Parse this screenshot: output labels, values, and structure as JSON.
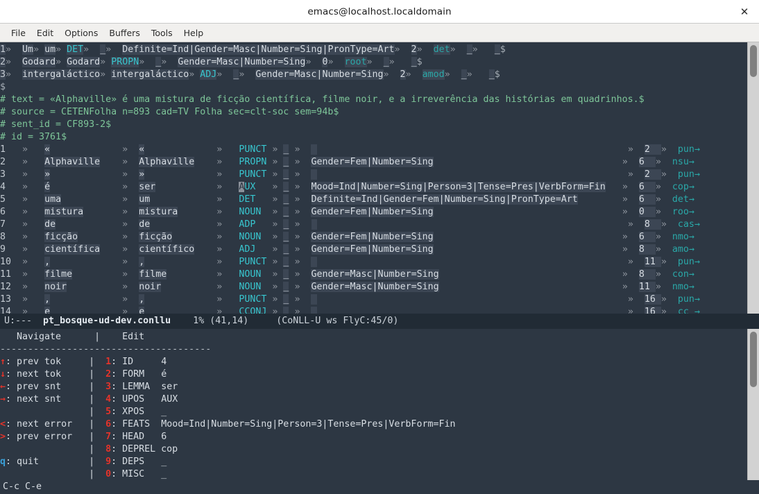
{
  "window": {
    "title": "emacs@localhost.localdomain",
    "close_label": "✕"
  },
  "menubar": {
    "items": [
      {
        "label": "File"
      },
      {
        "label": "Edit"
      },
      {
        "label": "Options"
      },
      {
        "label": "Buffers"
      },
      {
        "label": "Tools"
      },
      {
        "label": "Help"
      }
    ]
  },
  "editor": {
    "tab_glyph": "»",
    "eol_glyph": "$",
    "truncate_glyph": "→",
    "prev_sentence": {
      "tokens": [
        {
          "id": "1",
          "form": "Um",
          "lemma": "um",
          "upos": "DET",
          "xpos": "_",
          "feats": "Definite=Ind|Gender=Masc|Number=Sing|PronType=Art",
          "head": "2",
          "deprel": "det",
          "deps": "_",
          "misc": "_"
        },
        {
          "id": "2",
          "form": "Godard",
          "lemma": "Godard",
          "upos": "PROPN",
          "xpos": "_",
          "feats": "Gender=Masc|Number=Sing",
          "head": "0",
          "deprel": "root",
          "deps": "_",
          "misc": "_"
        },
        {
          "id": "3",
          "form": "intergaláctico",
          "lemma": "intergaláctico",
          "upos": "ADJ",
          "xpos": "_",
          "feats": "Gender=Masc|Number=Sing",
          "head": "2",
          "deprel": "amod",
          "deps": "_",
          "misc": "_"
        }
      ]
    },
    "comments": [
      "# text = «Alphaville» é uma mistura de ficção científica, filme noir, e a irreverência das histórias em quadrinhos.",
      "# source = CETENFolha n=893 cad=TV Folha sec=clt-soc sem=94b",
      "# sent_id = CF893-2",
      "# id = 3761"
    ],
    "tokens": [
      {
        "id": "1",
        "form": "«",
        "lemma": "«",
        "upos": "PUNCT",
        "xpos": "_",
        "feats": "_",
        "head": "2",
        "deprel": "pun"
      },
      {
        "id": "2",
        "form": "Alphaville",
        "lemma": "Alphaville",
        "upos": "PROPN",
        "xpos": "_",
        "feats": "Gender=Fem|Number=Sing",
        "head": "6",
        "deprel": "nsu"
      },
      {
        "id": "3",
        "form": "»",
        "lemma": "»",
        "upos": "PUNCT",
        "xpos": "_",
        "feats": "_",
        "head": "2",
        "deprel": "pun"
      },
      {
        "id": "4",
        "form": "é",
        "lemma": "ser",
        "upos": "AUX",
        "xpos": "_",
        "feats": "Mood=Ind|Number=Sing|Person=3|Tense=Pres|VerbForm=Fin",
        "head": "6",
        "deprel": "cop"
      },
      {
        "id": "5",
        "form": "uma",
        "lemma": "um",
        "upos": "DET",
        "xpos": "_",
        "feats": "Definite=Ind|Gender=Fem|Number=Sing|PronType=Art",
        "head": "6",
        "deprel": "det"
      },
      {
        "id": "6",
        "form": "mistura",
        "lemma": "mistura",
        "upos": "NOUN",
        "xpos": "_",
        "feats": "Gender=Fem|Number=Sing",
        "head": "0",
        "deprel": "roo"
      },
      {
        "id": "7",
        "form": "de",
        "lemma": "de",
        "upos": "ADP",
        "xpos": "_",
        "feats": "_",
        "head": "8",
        "deprel": "cas"
      },
      {
        "id": "8",
        "form": "ficção",
        "lemma": "ficção",
        "upos": "NOUN",
        "xpos": "_",
        "feats": "Gender=Fem|Number=Sing",
        "head": "6",
        "deprel": "nmo"
      },
      {
        "id": "9",
        "form": "científica",
        "lemma": "científico",
        "upos": "ADJ",
        "xpos": "_",
        "feats": "Gender=Fem|Number=Sing",
        "head": "8",
        "deprel": "amo"
      },
      {
        "id": "10",
        "form": ",",
        "lemma": ",",
        "upos": "PUNCT",
        "xpos": "_",
        "feats": "_",
        "head": "11",
        "deprel": "pun"
      },
      {
        "id": "11",
        "form": "filme",
        "lemma": "filme",
        "upos": "NOUN",
        "xpos": "_",
        "feats": "Gender=Masc|Number=Sing",
        "head": "8",
        "deprel": "con"
      },
      {
        "id": "12",
        "form": "noir",
        "lemma": "noir",
        "upos": "NOUN",
        "xpos": "_",
        "feats": "Gender=Masc|Number=Sing",
        "head": "11",
        "deprel": "nmo"
      },
      {
        "id": "13",
        "form": ",",
        "lemma": ",",
        "upos": "PUNCT",
        "xpos": "_",
        "feats": "_",
        "head": "16",
        "deprel": "pun"
      },
      {
        "id": "14",
        "form": "e",
        "lemma": "e",
        "upos": "CCONJ",
        "xpos": "_",
        "feats": "_",
        "head": "16",
        "deprel": "cc"
      }
    ]
  },
  "modeline": {
    "flags": "U:---",
    "buffer_name": "pt_bosque-ud-dev.conllu",
    "percent": "1%",
    "position": "(41,14)",
    "modes": "(CoNLL-U ws FlyC:45/0)"
  },
  "help_panel": {
    "headers": {
      "navigate": "Navigate",
      "separator": "|",
      "edit": "Edit"
    },
    "rule": "--------------------------------------",
    "navigate": [
      {
        "key": "↑",
        "key_color": "red",
        "label": "prev tok"
      },
      {
        "key": "↓",
        "key_color": "red",
        "label": "next tok"
      },
      {
        "key": "←",
        "key_color": "red",
        "label": "prev snt"
      },
      {
        "key": "→",
        "key_color": "red",
        "label": "next snt"
      },
      {
        "key": "",
        "key_color": "none",
        "label": ""
      },
      {
        "key": "<",
        "key_color": "red",
        "label": "next error"
      },
      {
        "key": ">",
        "key_color": "red",
        "label": "prev error"
      },
      {
        "key": "",
        "key_color": "none",
        "label": ""
      },
      {
        "key": "q",
        "key_color": "blue",
        "label": "quit"
      }
    ],
    "edit": [
      {
        "key": "1",
        "field": "ID",
        "value": "4"
      },
      {
        "key": "2",
        "field": "FORM",
        "value": "é"
      },
      {
        "key": "3",
        "field": "LEMMA",
        "value": "ser"
      },
      {
        "key": "4",
        "field": "UPOS",
        "value": "AUX"
      },
      {
        "key": "5",
        "field": "XPOS",
        "value": "_"
      },
      {
        "key": "6",
        "field": "FEATS",
        "value": "Mood=Ind|Number=Sing|Person=3|Tense=Pres|VerbForm=Fin"
      },
      {
        "key": "7",
        "field": "HEAD",
        "value": "6"
      },
      {
        "key": "8",
        "field": "DEPREL",
        "value": "cop"
      },
      {
        "key": "9",
        "field": "DEPS",
        "value": "_"
      },
      {
        "key": "0",
        "field": "MISC",
        "value": "_"
      }
    ]
  },
  "echo_area": {
    "text": "C-c C-e"
  },
  "colors": {
    "background": "#2d3743",
    "modeline_bg": "#212b35",
    "upos": "#38c6cf",
    "deprel": "#2aa8a8",
    "comment": "#7ec699",
    "key_red": "#e4332a",
    "key_blue": "#3aa0d8",
    "cursor": "#8a9099"
  }
}
